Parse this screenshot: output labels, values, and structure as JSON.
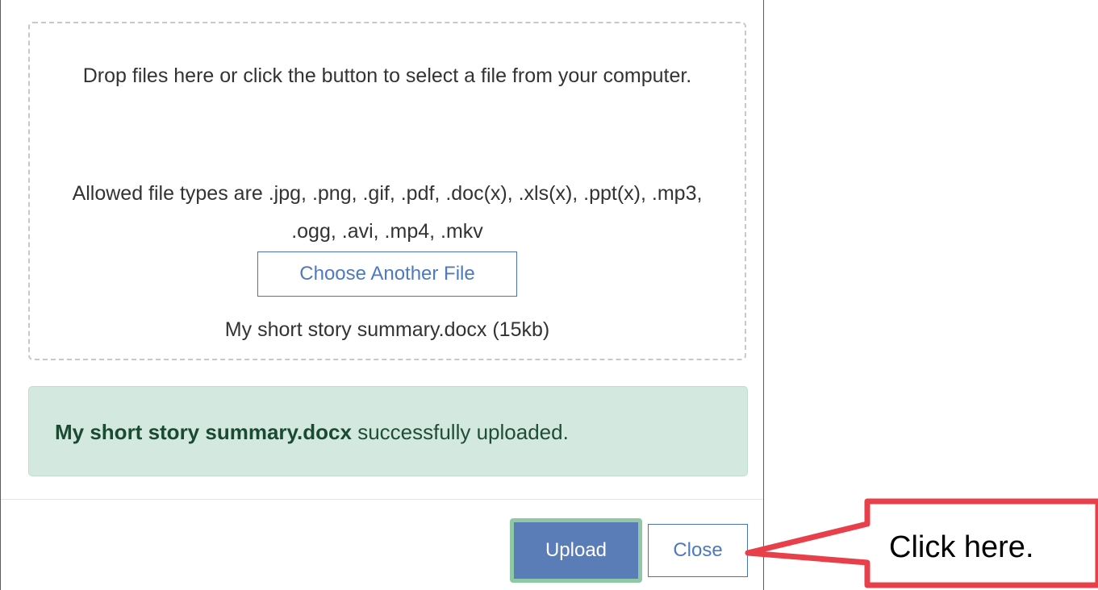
{
  "dropzone": {
    "instructions": "Drop files here or click the button to select a file from your computer.",
    "allowed_types": "Allowed file types are .jpg, .png, .gif, .pdf, .doc(x), .xls(x), .ppt(x), .mp3, .ogg, .avi, .mp4, .mkv",
    "choose_button_label": "Choose Another File",
    "selected_file": "My short story summary.docx (15kb)"
  },
  "alert": {
    "filename": "My short story summary.docx",
    "message": " successfully uploaded."
  },
  "footer": {
    "upload_label": "Upload",
    "close_label": "Close"
  },
  "annotation": {
    "callout_text": "Click here."
  },
  "colors": {
    "accent": "#4f79bf",
    "upload_fill": "#5b7db7",
    "success_bg": "#d3e8de",
    "callout_border": "#e8404a"
  }
}
